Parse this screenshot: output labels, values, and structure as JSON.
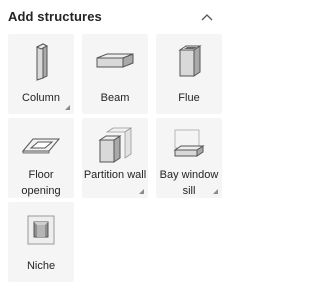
{
  "header": {
    "title": "Add structures",
    "collapse_icon": "chevron-up-icon"
  },
  "tiles": [
    {
      "label": "Column",
      "icon": "column-icon",
      "has_more": true
    },
    {
      "label": "Beam",
      "icon": "beam-icon",
      "has_more": false
    },
    {
      "label": "Flue",
      "icon": "flue-icon",
      "has_more": false
    },
    {
      "label": "Floor opening",
      "icon": "floor-opening-icon",
      "has_more": false
    },
    {
      "label": "Partition wall",
      "icon": "partition-wall-icon",
      "has_more": true
    },
    {
      "label": "Bay window sill",
      "icon": "bay-window-sill-icon",
      "has_more": true
    },
    {
      "label": "Niche",
      "icon": "niche-icon",
      "has_more": false
    }
  ]
}
